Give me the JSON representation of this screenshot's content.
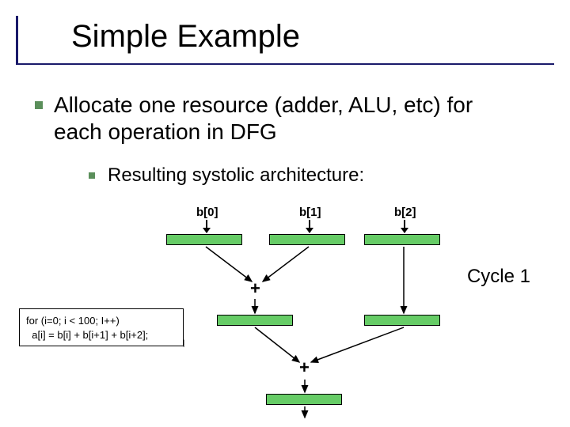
{
  "title": "Simple Example",
  "bullets": {
    "b1": "Allocate one resource (adder, ALU, etc) for each operation in DFG",
    "b2": "Resulting systolic architecture:"
  },
  "labels": {
    "b0": "b[0]",
    "b1": "b[1]",
    "b2": "b[2]"
  },
  "ops": {
    "plus1": "+",
    "plus2": "+"
  },
  "cycle": "Cycle 1",
  "code": {
    "line1": "for (i=0; i < 100; I++)",
    "line2": "  a[i] = b[i] + b[i+1] + b[i+2];"
  }
}
